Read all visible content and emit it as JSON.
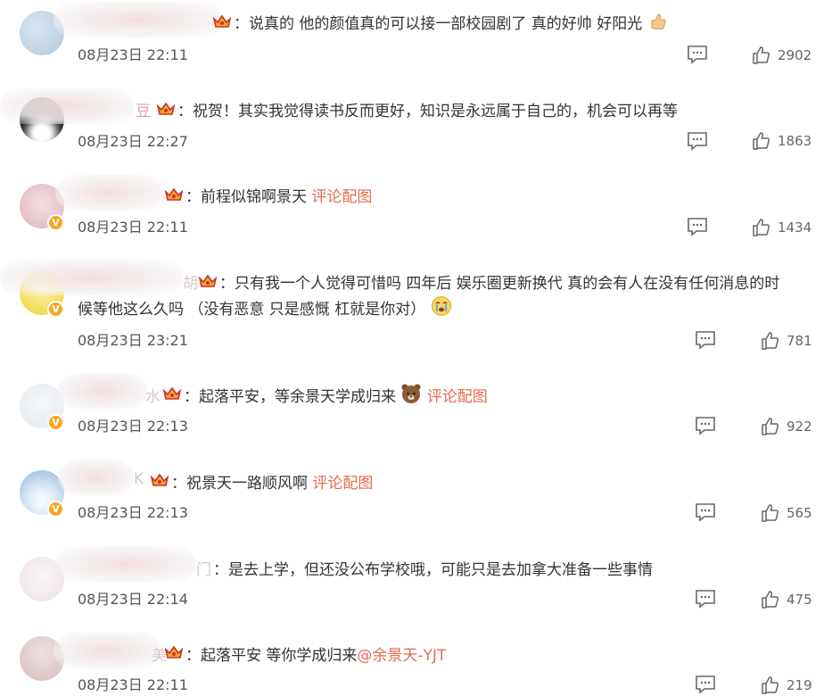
{
  "comments": [
    {
      "name_tail": "",
      "text": "：说真的 他的颜值真的可以接一部校园剧了 真的好帅 好阳光",
      "emoji": "thumbs-up",
      "continuation": "",
      "link": "",
      "time": "08月23日 22:11",
      "likes": "2902",
      "verified": false,
      "avatar_color": "#b9cfe0"
    },
    {
      "name_tail": "豆",
      "text": "：祝贺！其实我觉得读书反而更好，知识是永远属于自己的，机会可以再等",
      "emoji": "",
      "continuation": "",
      "link": "",
      "time": "08月23日 22:27",
      "likes": "1863",
      "verified": false,
      "avatar_color": "#2a2a2a"
    },
    {
      "name_tail": "",
      "text": "：前程似锦啊景天 ",
      "emoji": "",
      "continuation": "",
      "link": "评论配图",
      "time": "08月23日 22:11",
      "likes": "1434",
      "verified": true,
      "avatar_color": "#e9c6cd"
    },
    {
      "name_tail": "胡",
      "text": "：只有我一个人觉得可惜吗 四年后 娱乐圈更新换代 真的会有人在没有任何消息的时",
      "emoji": "crying-face",
      "continuation": "候等他这么久吗 （没有恶意 只是感慨 杠就是你对）",
      "link": "",
      "time": "08月23日 23:21",
      "likes": "781",
      "verified": true,
      "avatar_color": "#f3e36a"
    },
    {
      "name_tail": "水",
      "text": "：起落平安，等余景天学成归来",
      "emoji": "bear",
      "continuation": "",
      "link": "评论配图",
      "time": "08月23日 22:13",
      "likes": "922",
      "verified": true,
      "avatar_color": "#e9eef3"
    },
    {
      "name_tail": "K",
      "text": "：祝景天一路顺风啊 ",
      "emoji": "",
      "continuation": "",
      "link": "评论配图",
      "time": "08月23日 22:13",
      "likes": "565",
      "verified": true,
      "avatar_color": "#c7dbf0"
    },
    {
      "name_tail": "门",
      "text": "：是去上学，但还没公布学校哦，可能只是去加拿大准备一些事情",
      "emoji": "",
      "continuation": "",
      "link": "",
      "time": "08月23日 22:14",
      "likes": "475",
      "verified": false,
      "avatar_color": "#f1e6ea"
    },
    {
      "name_tail": "美",
      "text": "：起落平安 等你学成归来",
      "emoji": "",
      "continuation": "",
      "link": "@余景天-YJT",
      "time": "08月23日 22:11",
      "likes": "219",
      "verified": false,
      "avatar_color": "#e3d0d0"
    }
  ]
}
